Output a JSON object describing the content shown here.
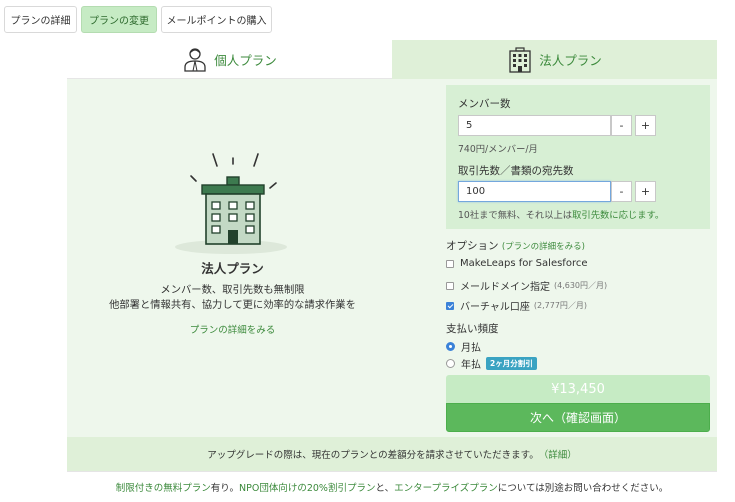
{
  "top_tabs": [
    {
      "label": "プランの詳細"
    },
    {
      "label": "プランの変更"
    },
    {
      "label": "メールポイントの購入"
    }
  ],
  "plan_tabs": {
    "personal": "個人プラン",
    "corporate": "法人プラン"
  },
  "description": {
    "title": "法人プラン",
    "line1": "メンバー数、取引先数も無制限",
    "line2": "他部署と情報共有、協力して更に効率的な請求作業を",
    "link": "プランの詳細をみる"
  },
  "form": {
    "members_label": "メンバー数",
    "members_value": "5",
    "members_note": "740円/メンバー/月",
    "clients_label": "取引先数／書類の宛先数",
    "clients_value": "100",
    "clients_note_prefix": "10社まで無料、それ以上は",
    "clients_note_link": "取引先数に応じます。",
    "minus": "-",
    "plus": "+"
  },
  "options": {
    "title": "オプション",
    "title_link": "(プランの詳細をみる)",
    "items": [
      {
        "label": "MakeLeaps for Salesforce",
        "sub": "",
        "checked": false
      },
      {
        "label": "メールドメイン指定",
        "sub": "(4,630円／月)",
        "checked": false
      },
      {
        "label": "バーチャル口座",
        "sub": "(2,777円／月)",
        "checked": true
      }
    ]
  },
  "payment": {
    "title": "支払い頻度",
    "monthly": "月払",
    "yearly": "年払",
    "yearly_badge": "2ヶ月分割引"
  },
  "price": "¥13,450",
  "next_button": "次へ（確認画面）",
  "notice": {
    "text": "アップグレードの際は、現在のプランとの差額分を請求させていただきます。",
    "link": "（詳細）"
  },
  "footer": {
    "part1": "制限付きの無料プラン",
    "part2": "有り。",
    "part3": "NPO団体向けの20%割引プラン",
    "part4": "と、",
    "part5": "エンタープライズプラン",
    "part6": "については別途お問い合わせください。"
  },
  "colors": {
    "brand_green": "#5cb85c",
    "light_green": "#dff0d8",
    "link_green": "#3c8a3c",
    "accent_blue": "#3b82d8"
  }
}
